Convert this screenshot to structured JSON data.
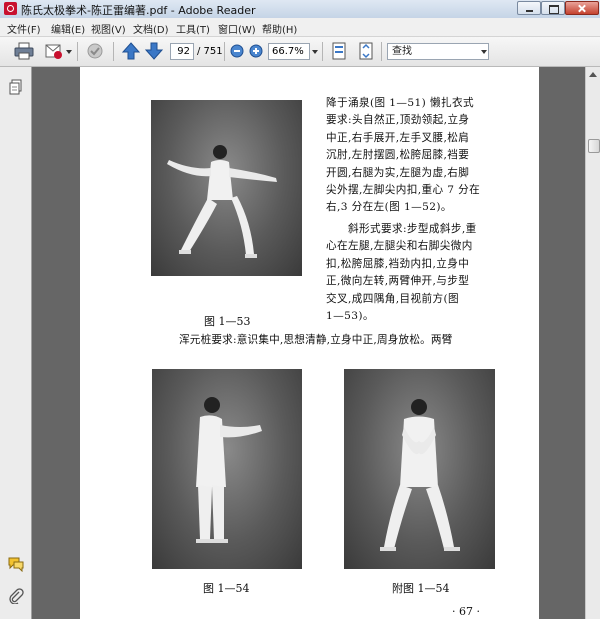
{
  "window": {
    "title": "陈氏太极拳术-陈正雷编著.pdf - Adobe Reader"
  },
  "menu": {
    "items": [
      "文件(F)",
      "编辑(E)",
      "视图(V)",
      "文档(D)",
      "工具(T)",
      "窗口(W)",
      "帮助(H)"
    ]
  },
  "toolbar": {
    "page_current": "92",
    "page_total": "/ 751",
    "zoom": "66.7%",
    "search_placeholder": "查找",
    "icons": [
      "print-icon",
      "email-attach-icon",
      "secure-icon",
      "prev-page-icon",
      "next-page-icon",
      "zoom-out-icon",
      "zoom-in-icon",
      "fit-page-icon",
      "fit-width-icon",
      "search-dropdown-icon"
    ]
  },
  "nav": {
    "icons": [
      "pages-icon",
      "comments-icon",
      "attachments-icon"
    ]
  },
  "document": {
    "paragraph1": [
      "降于涌泉(图 1—51)  懒扎衣式",
      "要求:头自然正,顶劲领起,立身",
      "中正,右手展开,左手叉腰,松肩",
      "沉肘,左肘摆圆,松胯屈膝,裆要",
      "开圆,右腿为实,左腿为虚,右脚",
      "尖外摆,左脚尖内扣,重心 7 分在",
      "右,3 分在左(图 1—52)。"
    ],
    "paragraph2": [
      "斜形式要求:步型成斜步,重",
      "心在左腿,左腿尖和右脚尖微内",
      "扣,松胯屈膝,裆劲内扣,立身中",
      "正,微向左转,两臂伸开,与步型",
      "交叉,成四隅角,目视前方(图",
      "1—53)。"
    ],
    "paragraph3": "浑元桩要求:意识集中,思想清静,立身中正,周身放松。两臂",
    "captions": {
      "fig53": "图 1—53",
      "fig54": "图 1—54",
      "fig54b": "附图 1—54"
    },
    "page_number": "· 67 ·"
  }
}
